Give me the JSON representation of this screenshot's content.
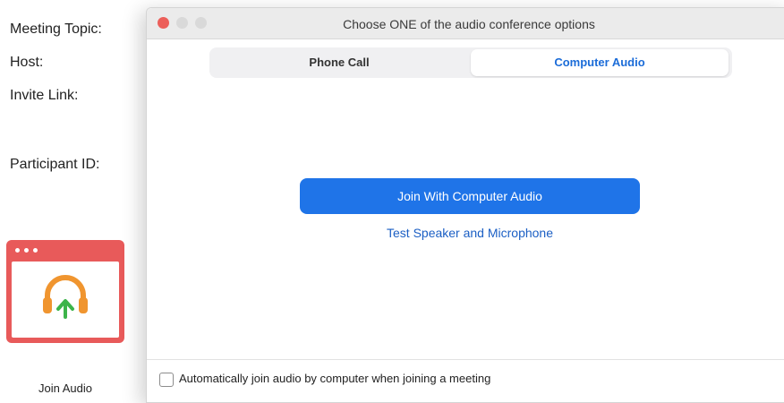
{
  "meeting_info": {
    "topic_label": "Meeting Topic:",
    "host_label": "Host:",
    "invite_label": "Invite Link:",
    "participant_label": "Participant ID:"
  },
  "join_audio": {
    "label": "Join Audio",
    "icon": "headphones-upload-icon"
  },
  "dialog": {
    "title": "Choose ONE of the audio conference options",
    "tabs": [
      {
        "label": "Phone Call",
        "selected": false
      },
      {
        "label": "Computer Audio",
        "selected": true
      }
    ],
    "join_button_label": "Join With Computer Audio",
    "test_link_label": "Test Speaker and Microphone",
    "auto_join_label": "Automatically join audio by computer when joining a meeting",
    "auto_join_checked": false
  },
  "colors": {
    "accent_blue": "#1f74e8",
    "tile_red": "#e85a5a",
    "headphone_orange": "#f0952f",
    "arrow_green": "#3cb44a"
  }
}
